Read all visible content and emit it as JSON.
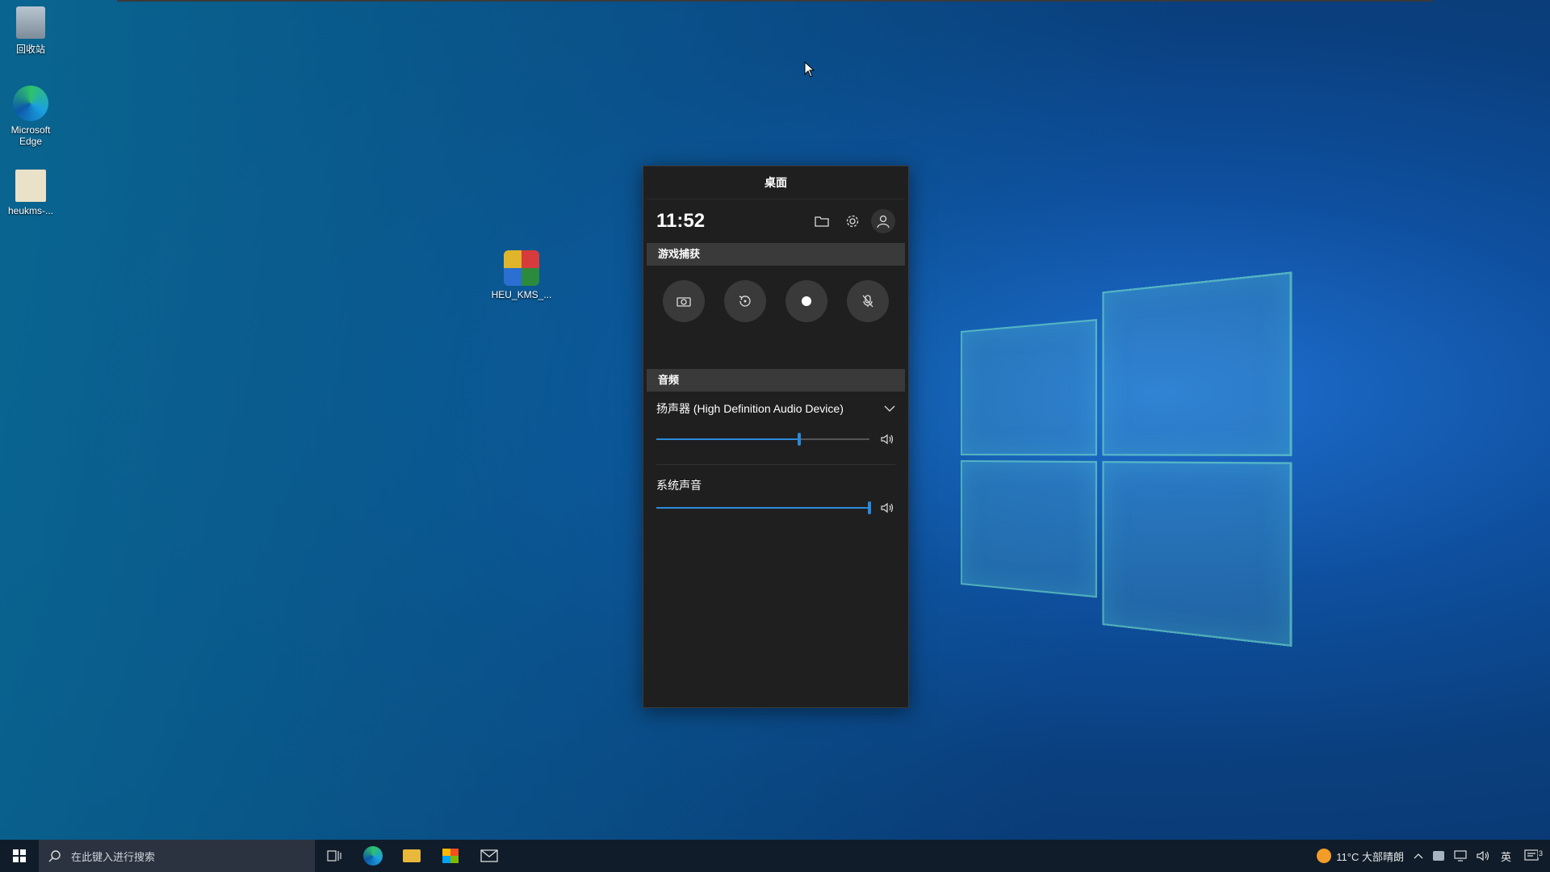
{
  "desktop": {
    "icons": [
      {
        "label": "回收站"
      },
      {
        "label": "Microsoft Edge"
      },
      {
        "label": "heukms-..."
      },
      {
        "label": "HEU_KMS_..."
      }
    ]
  },
  "gamebar": {
    "title": "桌面",
    "time": "11:52",
    "capture_section": "游戏捕获",
    "audio_section": "音频",
    "device": "扬声器 (High Definition Audio Device)",
    "device_volume_fraction": 0.67,
    "system_sound_label": "系统声音",
    "system_volume_fraction": 1.0
  },
  "taskbar": {
    "search_placeholder": "在此键入进行搜索",
    "weather": "11°C  大部晴朗",
    "ime": "英",
    "notification_count": "3"
  }
}
